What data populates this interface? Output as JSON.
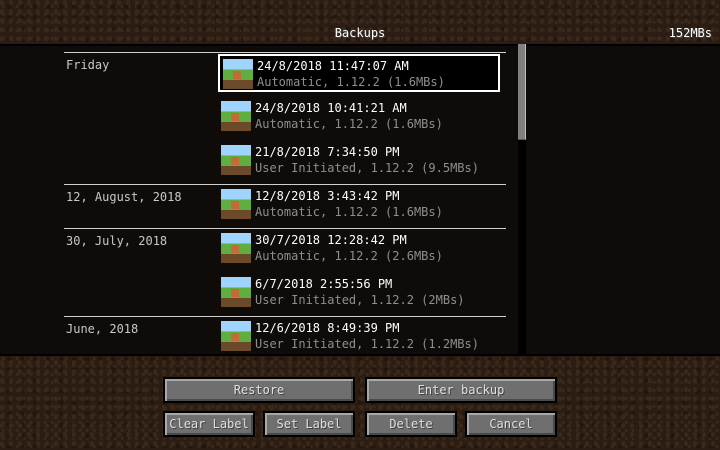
{
  "header": {
    "title": "Backups",
    "storage_used": "152MBs"
  },
  "groups": [
    {
      "label": "Friday",
      "entries": [
        {
          "datetime": "24/8/2018 11:47:07 AM",
          "details": "Automatic, 1.12.2 (1.6MBs)",
          "selected": true
        },
        {
          "datetime": "24/8/2018 10:41:21 AM",
          "details": "Automatic, 1.12.2 (1.6MBs)"
        },
        {
          "datetime": "21/8/2018 7:34:50 PM",
          "details": "User Initiated, 1.12.2 (9.5MBs)"
        }
      ]
    },
    {
      "label": "12, August, 2018",
      "entries": [
        {
          "datetime": "12/8/2018 3:43:42 PM",
          "details": "Automatic, 1.12.2 (1.6MBs)"
        }
      ]
    },
    {
      "label": "30, July, 2018",
      "entries": [
        {
          "datetime": "30/7/2018 12:28:42 PM",
          "details": "Automatic, 1.12.2 (2.6MBs)"
        },
        {
          "datetime": "6/7/2018 2:55:56 PM",
          "details": "User Initiated, 1.12.2 (2MBs)"
        }
      ]
    },
    {
      "label": "June, 2018",
      "entries": [
        {
          "datetime": "12/6/2018 8:49:39 PM",
          "details": "User Initiated, 1.12.2 (1.2MBs)"
        }
      ]
    }
  ],
  "buttons": {
    "restore": "Restore",
    "enter_backup": "Enter backup",
    "clear_label": "Clear Label",
    "set_label": "Set Label",
    "delete": "Delete",
    "cancel": "Cancel"
  }
}
